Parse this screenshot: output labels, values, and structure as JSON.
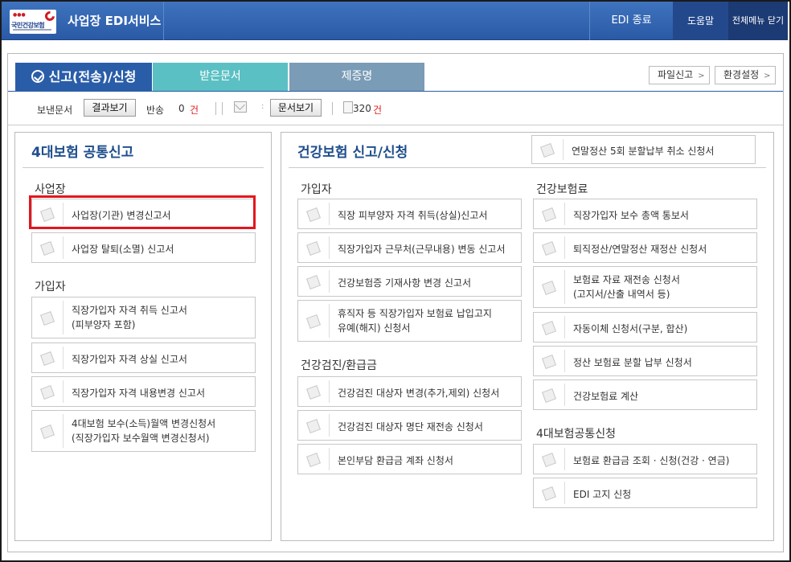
{
  "header": {
    "logo_text": "국민건강보험",
    "app_title": "사업장 EDI서비스",
    "edi_exit": "EDI 종료",
    "help": "도움말",
    "close_all": "전체메뉴 닫기"
  },
  "tabs": {
    "report": "신고(전송)/신청",
    "received": "받은문서",
    "certificate": "제증명"
  },
  "header_buttons": {
    "file_report": "파일신고",
    "settings": "환경설정"
  },
  "toolbar": {
    "pending_label": "보낸문서",
    "result_button": "결과보기",
    "returned_label": "반송",
    "returned_count": "0",
    "count_unit": "건",
    "doc_view_button": "문서보기",
    "doc_count": "320",
    "doc_unit": "건"
  },
  "left_section": {
    "title": "4대보험 공통신고",
    "workplace_title": "사업장",
    "workplace_items": [
      "사업장(기관) 변경신고서",
      "사업장 탈퇴(소멸) 신고서"
    ],
    "subscriber_title": "가입자",
    "subscriber_items": [
      "직장가입자 자격 취득 신고서\n(피부양자 포함)",
      "직장가입자 자격 상실 신고서",
      "직장가입자 자격 내용변경 신고서",
      "4대보험 보수(소득)월액 변경신청서\n(직장가입자 보수월액 변경신청서)"
    ]
  },
  "right_section": {
    "title": "건강보험 신고/신청",
    "top_item": "연말정산 5회 분할납부 취소 신청서",
    "subscriber_title": "가입자",
    "subscriber_items": [
      "직장 피부양자 자격 취득(상실)신고서",
      "직장가입자 근무처(근무내용) 변동 신고서",
      "건강보험증 기재사항 변경 신고서",
      "휴직자 등 직장가입자 보험료 납입고지\n유예(해지) 신청서"
    ],
    "checkup_title": "건강검진/환급금",
    "checkup_items": [
      "건강검진 대상자 변경(추가,제외) 신청서",
      "건강검진 대상자 명단 재전송 신청서",
      "본인부담 환급금 계좌 신청서"
    ],
    "premium_title": "건강보험료",
    "premium_items": [
      "직장가입자 보수 총액 통보서",
      "퇴직정산/연말정산 재정산 신청서",
      "보험료 자료 재전송 신청서\n(고지서/산출 내역서 등)",
      "자동이체 신청서(구분, 합산)",
      "정산 보험료 분할 납부 신청서",
      "건강보험료 계산"
    ],
    "common_title": "4대보험공통신청",
    "common_items": [
      "보험료 환급금 조회 · 신청(건강 · 연금)",
      "EDI 고지 신청"
    ]
  }
}
